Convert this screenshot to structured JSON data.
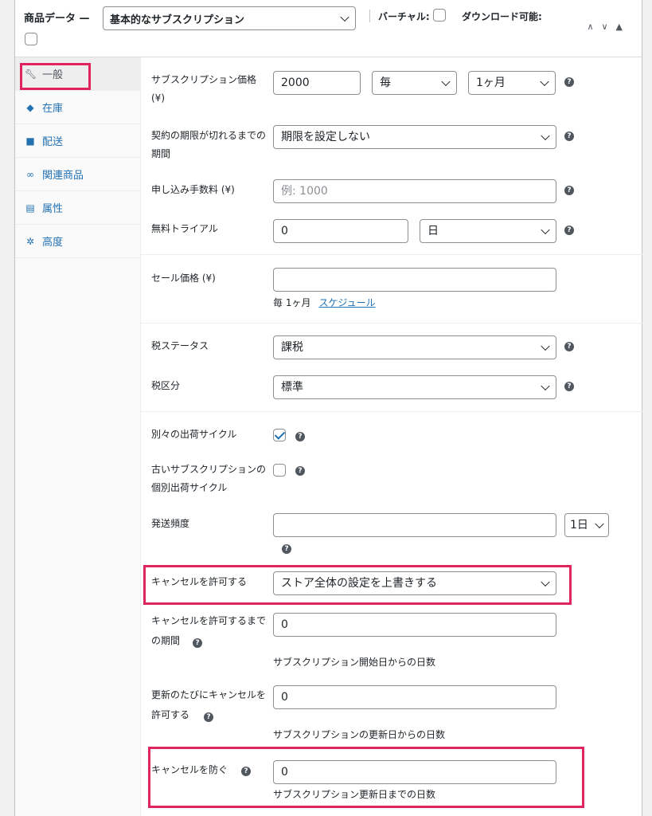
{
  "header": {
    "title": "商品データ —",
    "product_type": "基本的なサブスクリプション",
    "virtual_label": "バーチャル:",
    "downloadable_label": "ダウンロード可能:",
    "arrows": "∧∨▲"
  },
  "sidebar": {
    "items": [
      {
        "label": "一般",
        "icon": "wrench-icon"
      },
      {
        "label": "在庫",
        "icon": "tag-icon"
      },
      {
        "label": "配送",
        "icon": "truck-icon"
      },
      {
        "label": "関連商品",
        "icon": "link-icon"
      },
      {
        "label": "属性",
        "icon": "table-icon"
      },
      {
        "label": "高度",
        "icon": "gear-icon"
      }
    ]
  },
  "fields": {
    "sub_price_label": "サブスクリプション価格",
    "sub_price_unit": "(¥)",
    "sub_price_value": "2000",
    "sub_period_every": "毎",
    "sub_period_interval": "1ヶ月",
    "expire_label_1": "契約の期限が切れるまでの",
    "expire_label_2": "期間",
    "expire_value": "期限を設定しない",
    "signup_fee_label": "申し込み手数料 (¥)",
    "signup_fee_placeholder": "例: 1000",
    "trial_label": "無料トライアル",
    "trial_value": "0",
    "trial_unit": "日",
    "sale_label": "セール価格 (¥)",
    "sale_value": "",
    "sale_note": "毎 1ヶ月",
    "schedule_link": "スケジュール",
    "tax_status_label": "税ステータス",
    "tax_status_value": "課税",
    "tax_class_label": "税区分",
    "tax_class_value": "標準",
    "separate_ship_label": "別々の出荷サイクル",
    "old_sub_label_1": "古いサブスクリプションの",
    "old_sub_label_2": "個別出荷サイクル",
    "ship_freq_label": "発送頻度",
    "ship_freq_value": "",
    "ship_freq_unit": "1日",
    "allow_cancel_label": "キャンセルを許可する",
    "allow_cancel_value": "ストア全体の設定を上書きする",
    "cancel_period_label_1": "キャンセルを許可するまで",
    "cancel_period_label_2": "の期間",
    "cancel_period_value": "0",
    "cancel_period_note": "サブスクリプション開始日からの日数",
    "cancel_renew_label_1": "更新のたびにキャンセルを",
    "cancel_renew_label_2": "許可する",
    "cancel_renew_value": "0",
    "cancel_renew_note": "サブスクリプションの更新日からの日数",
    "prevent_cancel_label": "キャンセルを防ぐ",
    "prevent_cancel_value": "0",
    "prevent_cancel_note": "サブスクリプション更新日までの日数"
  },
  "colors": {
    "accent": "#2271b1",
    "highlight": "#e0245e"
  }
}
